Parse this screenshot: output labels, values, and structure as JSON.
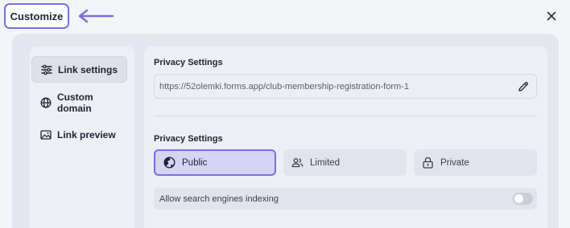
{
  "header": {
    "customize_label": "Customize"
  },
  "sidebar": {
    "items": [
      {
        "label": "Link settings",
        "icon": "sliders-icon",
        "active": true
      },
      {
        "label": "Custom domain",
        "icon": "globe-icon",
        "active": false
      },
      {
        "label": "Link preview",
        "icon": "image-icon",
        "active": false
      }
    ]
  },
  "main": {
    "link_section_title": "Privacy Settings",
    "url_value": "https://52olemki.forms.app/club-membership-registration-form-1",
    "privacy_section_title": "Privacy Settings",
    "privacy_options": [
      {
        "label": "Public",
        "icon": "globe-half-icon",
        "selected": true
      },
      {
        "label": "Limited",
        "icon": "users-icon",
        "selected": false
      },
      {
        "label": "Private",
        "icon": "lock-icon",
        "selected": false
      }
    ],
    "indexing_label": "Allow search engines indexing",
    "indexing_enabled": false
  },
  "colors": {
    "accent": "#7b6cf0",
    "selected_bg": "#d5d4f4",
    "panel_bg": "#e3e6ee"
  }
}
